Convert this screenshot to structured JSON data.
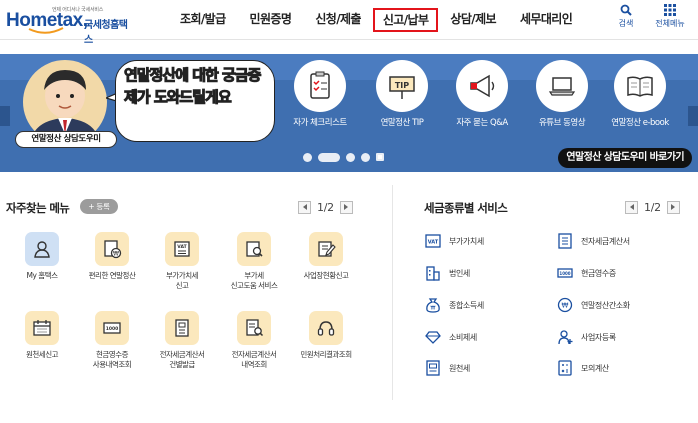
{
  "header": {
    "logo_tagline": "언제 어디서나 국세서비스",
    "logo_brand": "Hometax,",
    "logo_sub": "국세청홈택스",
    "nav": [
      {
        "label": "조회/발급",
        "active": false
      },
      {
        "label": "민원증명",
        "active": false
      },
      {
        "label": "신청/제출",
        "active": false
      },
      {
        "label": "신고/납부",
        "active": true
      },
      {
        "label": "상담/제보",
        "active": false
      },
      {
        "label": "세무대리인",
        "active": false
      }
    ],
    "search_label": "검색",
    "allmenu_label": "전체메뉴"
  },
  "banner": {
    "bubble_text": "연말정산에 대한 궁금증 제가 도와드릴게요",
    "character_label": "연말정산 상담도우미",
    "icons": [
      {
        "label": "자가 체크리스트",
        "icon": "checklist-icon"
      },
      {
        "label": "연말정산 TIP",
        "icon": "tip-sign-icon"
      },
      {
        "label": "자주 묻는 Q&A",
        "icon": "megaphone-icon"
      },
      {
        "label": "유튜브 동영상",
        "icon": "laptop-icon"
      },
      {
        "label": "연말정산 e-book",
        "icon": "book-icon"
      }
    ],
    "cta_label": "연말정산 상담도우미 바로가기"
  },
  "favorites": {
    "title": "자주찾는 메뉴",
    "register_label": "+ 등록",
    "page": "1/2",
    "items": [
      {
        "label": "My 홈택스",
        "icon": "user-icon"
      },
      {
        "label": "편리한 연말정산",
        "icon": "tax-document-icon"
      },
      {
        "label": "부가가치세\n신고",
        "icon": "vat-icon"
      },
      {
        "label": "부가세\n신고도움 서비스",
        "icon": "search-document-icon"
      },
      {
        "label": "사업장현황신고",
        "icon": "edit-document-icon"
      },
      {
        "label": "원천세신고",
        "icon": "calendar-icon"
      },
      {
        "label": "현금영수증\n사용내역조회",
        "icon": "receipt-icon"
      },
      {
        "label": "전자세금계산서\n건별발급",
        "icon": "invoice-icon"
      },
      {
        "label": "전자세금계산서\n내역조회",
        "icon": "invoice-search-icon"
      },
      {
        "label": "민원처리결과조회",
        "icon": "headset-icon"
      }
    ]
  },
  "tax_services": {
    "title": "세금종류별 서비스",
    "page": "1/2",
    "items": [
      {
        "label": "부가가치세",
        "icon": "vat-icon"
      },
      {
        "label": "전자세금계산서",
        "icon": "invoice-icon"
      },
      {
        "label": "법인세",
        "icon": "building-icon"
      },
      {
        "label": "현금영수증",
        "icon": "receipt-icon"
      },
      {
        "label": "종합소득세",
        "icon": "money-bag-icon"
      },
      {
        "label": "연말정산간소화",
        "icon": "won-coin-icon"
      },
      {
        "label": "소비제세",
        "icon": "diamond-icon"
      },
      {
        "label": "사업자등록",
        "icon": "person-register-icon"
      },
      {
        "label": "원천세",
        "icon": "document-icon"
      },
      {
        "label": "모의계산",
        "icon": "calculator-icon"
      }
    ]
  },
  "colors": {
    "brand": "#1a4fa0",
    "banner": "#3f6fb0",
    "active_border": "#e3141b",
    "icon_bg": "#fbe8bd"
  }
}
